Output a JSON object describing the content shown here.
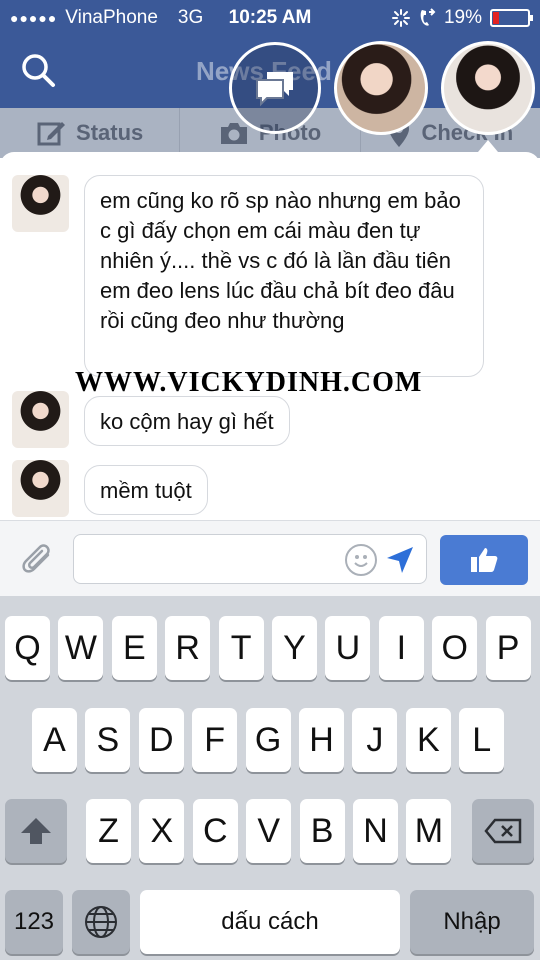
{
  "status_bar": {
    "signal_dots": "●●●●●",
    "carrier": "VinaPhone",
    "network": "3G",
    "time": "10:25 AM",
    "battery_percent": "19%",
    "battery_level": 0.19,
    "battery_color": "#e22222"
  },
  "header": {
    "title": "News Feed",
    "search_icon": "search-icon"
  },
  "action_bar": [
    {
      "label": "Status",
      "icon": "edit-icon"
    },
    {
      "label": "Photo",
      "icon": "camera-icon"
    },
    {
      "label": "Check In",
      "icon": "location-pin-icon"
    }
  ],
  "messages": [
    {
      "text": "em cũng ko rõ sp nào nhưng em bảo c gì đấy chọn em cái màu đen tự nhiên ý.... thề vs c đó là lần đầu tiên em đeo lens lúc đầu chả bít đeo đâu rồi cũng đeo như thường"
    },
    {
      "text": "ko cộm hay gì hết"
    },
    {
      "text": "mềm tuột"
    }
  ],
  "watermark": "WWW.VICKYDINH.COM",
  "composer": {
    "placeholder": "",
    "like_color": "#4a7bd3"
  },
  "keyboard": {
    "row1": [
      "Q",
      "W",
      "E",
      "R",
      "T",
      "Y",
      "U",
      "I",
      "O",
      "P"
    ],
    "row2": [
      "A",
      "S",
      "D",
      "F",
      "G",
      "H",
      "J",
      "K",
      "L"
    ],
    "row3": [
      "Z",
      "X",
      "C",
      "V",
      "B",
      "N",
      "M"
    ],
    "numbers_key": "123",
    "space_key": "dấu cách",
    "return_key": "Nhập"
  },
  "colors": {
    "facebook_blue": "#3b5998",
    "keyboard_bg": "#d1d5db"
  }
}
